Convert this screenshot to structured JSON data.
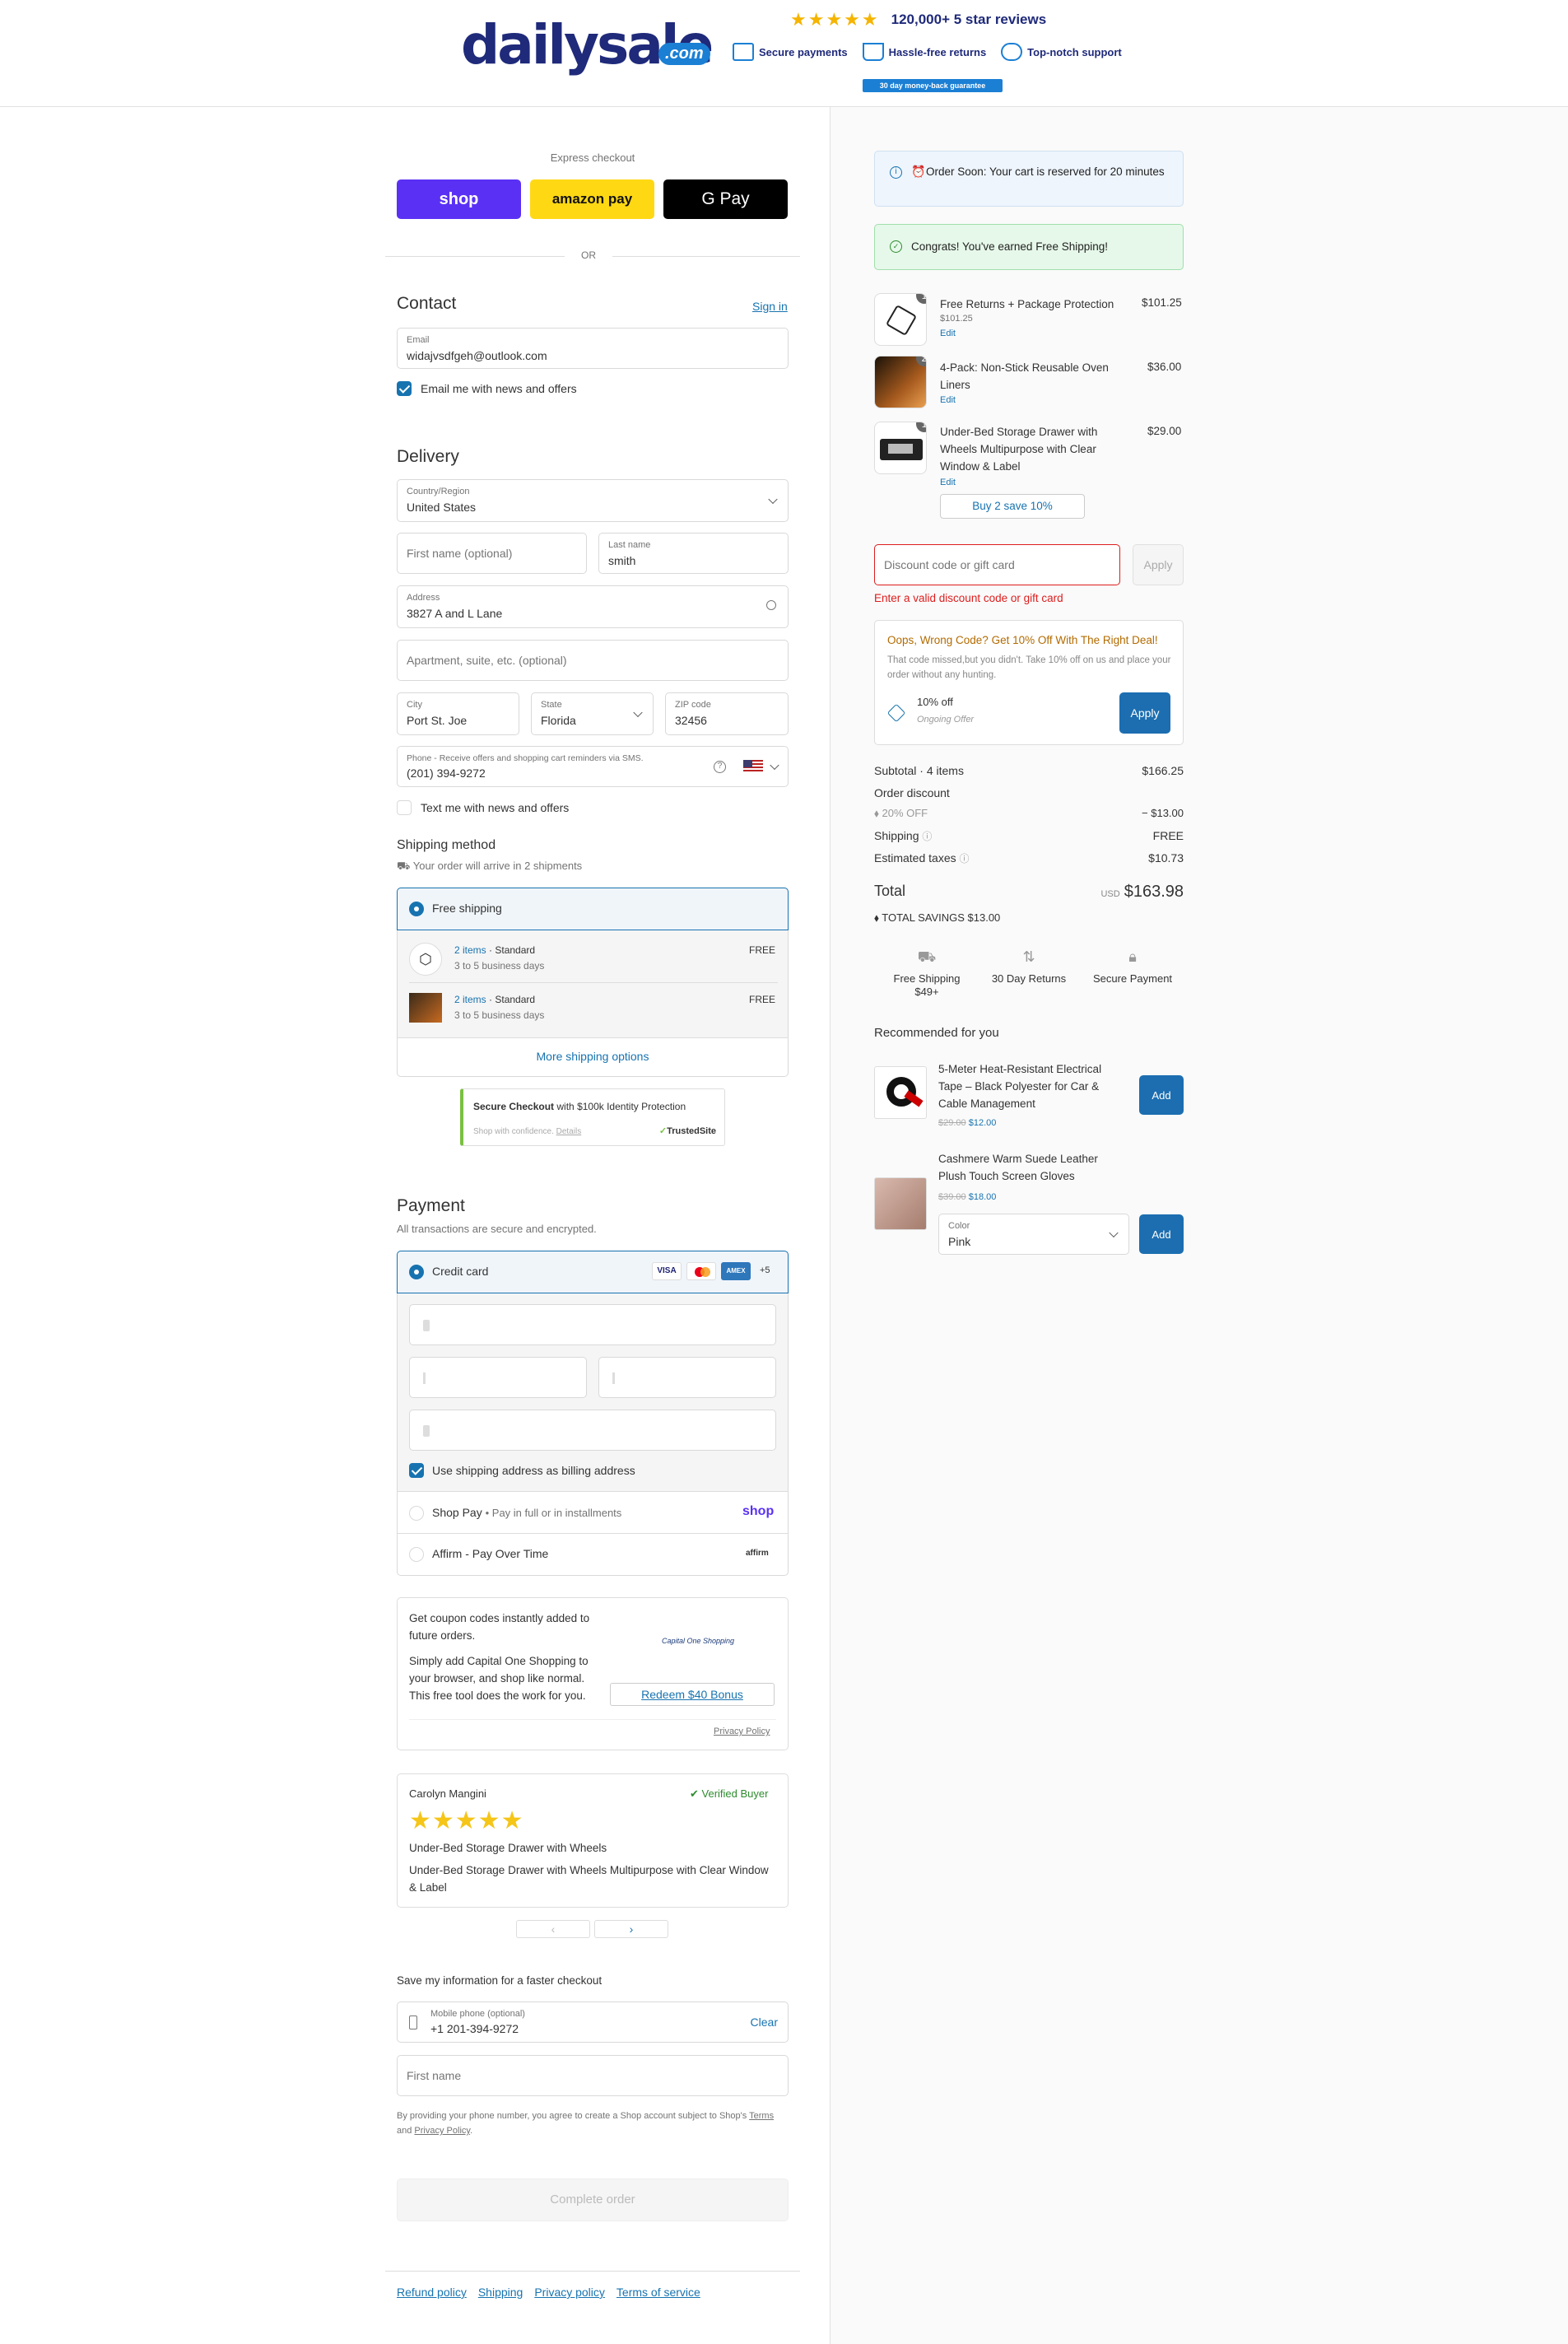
{
  "header": {
    "logo": "dailysale",
    "logo_suffix": ".com",
    "stars": "★★★★★",
    "reviews": "120,000+ 5 star reviews",
    "badges": [
      "Secure payments",
      "Hassle-free returns",
      "Top-notch support"
    ],
    "guarantee": "30 day money-back guarantee"
  },
  "express": {
    "title": "Express checkout",
    "shop": "shop",
    "amazon": "amazon pay",
    "gpay": "G Pay",
    "or": "OR"
  },
  "contact": {
    "title": "Contact",
    "sign_in": "Sign in",
    "email_label": "Email",
    "email": "widajvsdfgeh@outlook.com",
    "news": "Email me with news and offers"
  },
  "delivery": {
    "title": "Delivery",
    "country_label": "Country/Region",
    "country": "United States",
    "first_ph": "First name (optional)",
    "last_label": "Last name",
    "last": "smith",
    "address_label": "Address",
    "address": "3827 A and L Lane",
    "apt_ph": "Apartment, suite, etc. (optional)",
    "city_label": "City",
    "city": "Port St. Joe",
    "state_label": "State",
    "state": "Florida",
    "zip_label": "ZIP code",
    "zip": "32456",
    "phone_label": "Phone - Receive offers and shopping cart reminders via SMS.",
    "phone": "(201) 394-9272",
    "text_news": "Text me with news and offers"
  },
  "shipping": {
    "title": "Shipping method",
    "sub": "Your order will arrive in 2 shipments",
    "option": "Free shipping",
    "items": [
      {
        "items": "2 items",
        "type": "Standard",
        "days": "3 to 5 business days",
        "price": "FREE"
      },
      {
        "items": "2 items",
        "type": "Standard",
        "days": "3 to 5 business days",
        "price": "FREE"
      }
    ],
    "more": "More shipping options"
  },
  "trusted": {
    "title": "Secure Checkout",
    "rest": "with $100k Identity Protection",
    "sub": "Shop with confidence.",
    "details": "Details",
    "brand": "TrustedSite"
  },
  "payment": {
    "title": "Payment",
    "sub": "All transactions are secure and encrypted.",
    "cc": "Credit card",
    "more_cards": "+5",
    "billing": "Use shipping address as billing address",
    "shoppay": "Shop Pay",
    "shoppay_sub": "Pay in full or in installments",
    "affirm": "Affirm - Pay Over Time",
    "shop_logo": "shop",
    "affirm_logo": "affirm"
  },
  "capone": {
    "l1": "Get coupon codes instantly added to future orders.",
    "l2": "Simply add Capital One Shopping to your browser, and shop like normal. This free tool does the work for you.",
    "btn": "Redeem $40 Bonus",
    "policy": "Privacy Policy",
    "logo": "Capital One Shopping"
  },
  "review": {
    "name": "Carolyn Mangini",
    "verified": "Verified Buyer",
    "stars": "★★★★★",
    "title": "Under-Bed Storage Drawer with Wheels",
    "body": "Under-Bed Storage Drawer with Wheels Multipurpose with Clear Window & Label"
  },
  "save": {
    "title": "Save my information for a faster checkout",
    "phone_label": "Mobile phone (optional)",
    "phone": "+1 201-394-9272",
    "clear": "Clear",
    "first_ph": "First name",
    "legal1": "By providing your phone number, you agree to create a Shop account subject to Shop's",
    "terms": "Terms",
    "and": "and",
    "privacy": "Privacy Policy",
    "dot": "."
  },
  "complete": "Complete order",
  "footer": [
    "Refund policy",
    "Shipping",
    "Privacy policy",
    "Terms of service"
  ],
  "right": {
    "timer": "Order Soon: Your cart is reserved for 20 minutes",
    "congrats": "Congrats! You've earned Free Shipping!",
    "items": [
      {
        "qty": "1",
        "name": "Free Returns + Package Protection",
        "sub": "$101.25",
        "edit": "Edit",
        "price": "$101.25"
      },
      {
        "qty": "2",
        "name": "4-Pack: Non-Stick Reusable Oven Liners",
        "edit": "Edit",
        "price": "$36.00"
      },
      {
        "qty": "1",
        "name": "Under-Bed Storage Drawer with Wheels Multipurpose with Clear Window & Label",
        "edit": "Edit",
        "price": "$29.00",
        "buy": "Buy 2 save 10%"
      }
    ],
    "discount_ph": "Discount code or gift card",
    "apply": "Apply",
    "error": "Enter a valid discount code or gift card",
    "offer": {
      "title": "Oops, Wrong Code? Get 10% Off With The Right Deal!",
      "body": "That code missed,but you didn't. Take 10% off on us and place your order without any hunting.",
      "deal": "10% off",
      "ongoing": "Ongoing Offer",
      "apply": "Apply"
    },
    "subtotal_l": "Subtotal · 4 items",
    "subtotal": "$166.25",
    "odiscount_l": "Order discount",
    "code": "20% OFF",
    "code_v": "− $13.00",
    "shipping_l": "Shipping",
    "shipping_v": "FREE",
    "taxes_l": "Estimated taxes",
    "taxes_v": "$10.73",
    "total_l": "Total",
    "currency": "USD",
    "total": "$163.98",
    "savings": "TOTAL SAVINGS  $13.00",
    "perks": [
      "Free Shipping $49+",
      "30 Day Returns",
      "Secure Payment"
    ],
    "rec_title": "Recommended for you",
    "recs": [
      {
        "name": "5-Meter Heat-Resistant Electrical Tape – Black Polyester for Car & Cable Management",
        "old": "$29.00",
        "price": "$12.00",
        "btn": "Add"
      },
      {
        "name": "Cashmere Warm Suede Leather Plush Touch Screen Gloves",
        "old": "$39.00",
        "price": "$18.00",
        "color_label": "Color",
        "color": "Pink",
        "btn": "Add"
      }
    ]
  }
}
